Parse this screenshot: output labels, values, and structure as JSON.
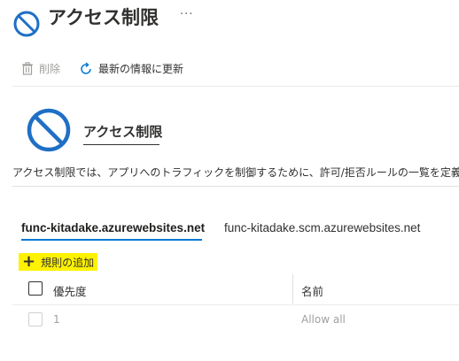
{
  "header": {
    "title": "アクセス制限",
    "more": "···"
  },
  "toolbar": {
    "delete_label": "削除",
    "refresh_label": "最新の情報に更新"
  },
  "section": {
    "title": "アクセス制限",
    "description": "アクセス制限では、アプリへのトラフィックを制御するために、許可/拒否ルールの一覧を定義で"
  },
  "tabs": [
    {
      "label": "func-kitadake.azurewebsites.net",
      "selected": true
    },
    {
      "label": "func-kitadake.scm.azurewebsites.net",
      "selected": false
    }
  ],
  "add_rule_label": "規則の追加",
  "table": {
    "columns": [
      "優先度",
      "名前"
    ],
    "rows": [
      {
        "priority": "1",
        "name": "Allow all"
      }
    ]
  },
  "colors": {
    "accent": "#0078d4",
    "highlight": "#fff200",
    "icon_blue": "#1f6fc5"
  }
}
